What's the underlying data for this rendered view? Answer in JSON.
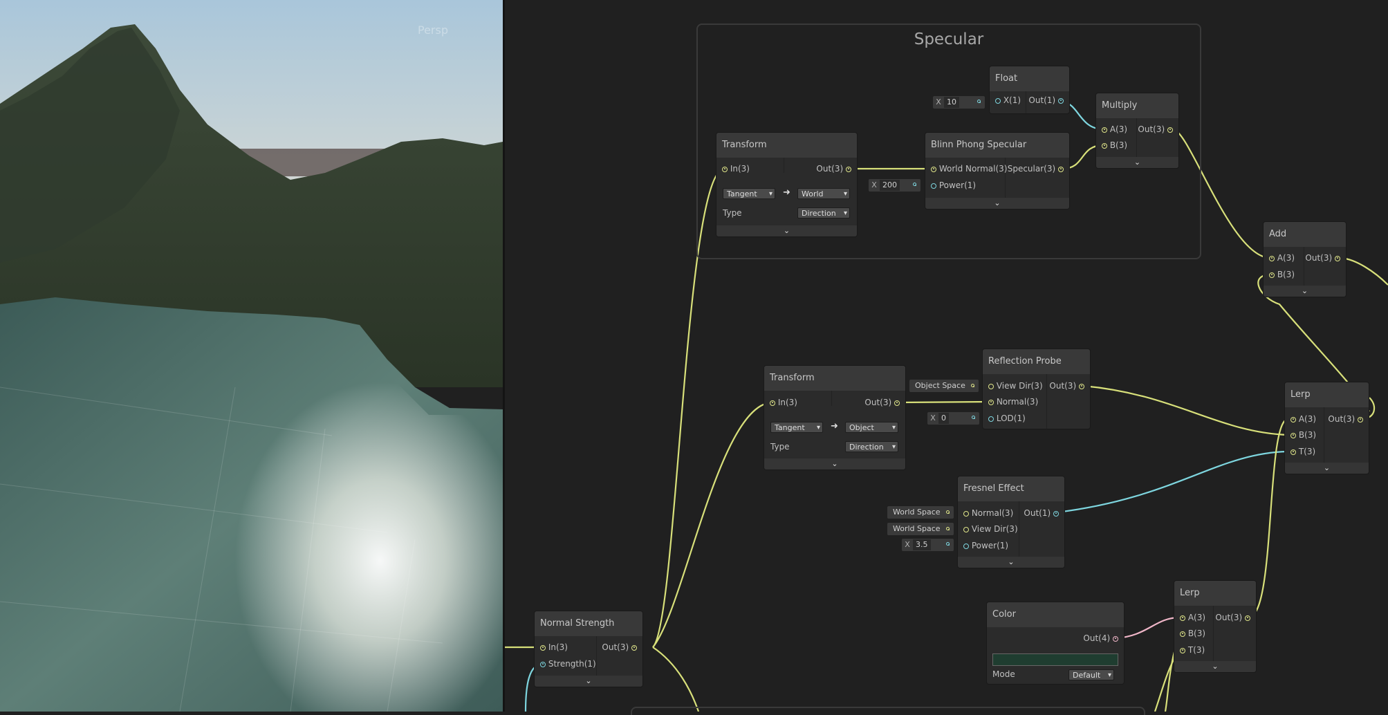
{
  "scene_view": {
    "camera_label": "Persp"
  },
  "groups": {
    "specular": {
      "title": "Specular"
    }
  },
  "nodes": {
    "float": {
      "title": "Float",
      "in_label": "X(1)",
      "out_label": "Out(1)",
      "inline_x": "X",
      "inline_value": "10"
    },
    "multiply": {
      "title": "Multiply",
      "in_a": "A(3)",
      "in_b": "B(3)",
      "out_label": "Out(3)",
      "footer": "⌄"
    },
    "blinn_phong": {
      "title": "Blinn Phong Specular",
      "in_normal": "World Normal(3)",
      "in_power": "Power(1)",
      "out_label": "Specular(3)",
      "inline_x": "X",
      "inline_value": "200",
      "footer": "⌄"
    },
    "transform_top": {
      "title": "Transform",
      "in_label": "In(3)",
      "out_label": "Out(3)",
      "from_space": "Tangent",
      "to_space": "World",
      "type_label": "Type",
      "type_value": "Direction",
      "footer": "⌄"
    },
    "add": {
      "title": "Add",
      "in_a": "A(3)",
      "in_b": "B(3)",
      "out_label": "Out(3)",
      "footer": "⌄"
    },
    "transform_mid": {
      "title": "Transform",
      "in_label": "In(3)",
      "out_label": "Out(3)",
      "from_space": "Tangent",
      "to_space": "Object",
      "type_label": "Type",
      "type_value": "Direction",
      "footer": "⌄"
    },
    "reflection_probe": {
      "title": "Reflection Probe",
      "in_view": "View Dir(3)",
      "in_normal": "Normal(3)",
      "in_lod": "LOD(1)",
      "out_label": "Out(3)",
      "inline_space": "Object Space",
      "inline_x": "X",
      "inline_value": "0"
    },
    "lerp_right": {
      "title": "Lerp",
      "in_a": "A(3)",
      "in_b": "B(3)",
      "in_t": "T(3)",
      "out_label": "Out(3)",
      "footer": "⌄"
    },
    "fresnel": {
      "title": "Fresnel Effect",
      "in_normal": "Normal(3)",
      "in_view": "View Dir(3)",
      "in_power": "Power(1)",
      "out_label": "Out(1)",
      "inline_normal_space": "World Space",
      "inline_view_space": "World Space",
      "inline_x": "X",
      "inline_value": "3.5",
      "footer": "⌄"
    },
    "normal_strength": {
      "title": "Normal Strength",
      "in_label": "In(3)",
      "in_strength": "Strength(1)",
      "out_label": "Out(3)",
      "footer": "⌄"
    },
    "color": {
      "title": "Color",
      "out_label": "Out(4)",
      "swatch": "#1f3d30",
      "mode_label": "Mode",
      "mode_value": "Default"
    },
    "lerp_bottom": {
      "title": "Lerp",
      "in_a": "A(3)",
      "in_b": "B(3)",
      "in_t": "T(3)",
      "out_label": "Out(3)",
      "footer": "⌄"
    }
  },
  "colors": {
    "vector3_wire": "#d8e07a",
    "float_wire": "#7ed6df",
    "vector4_wire": "#f0b6c8",
    "graph_bg": "#202020",
    "node_bg": "#2b2b2b",
    "node_header": "#393939"
  }
}
